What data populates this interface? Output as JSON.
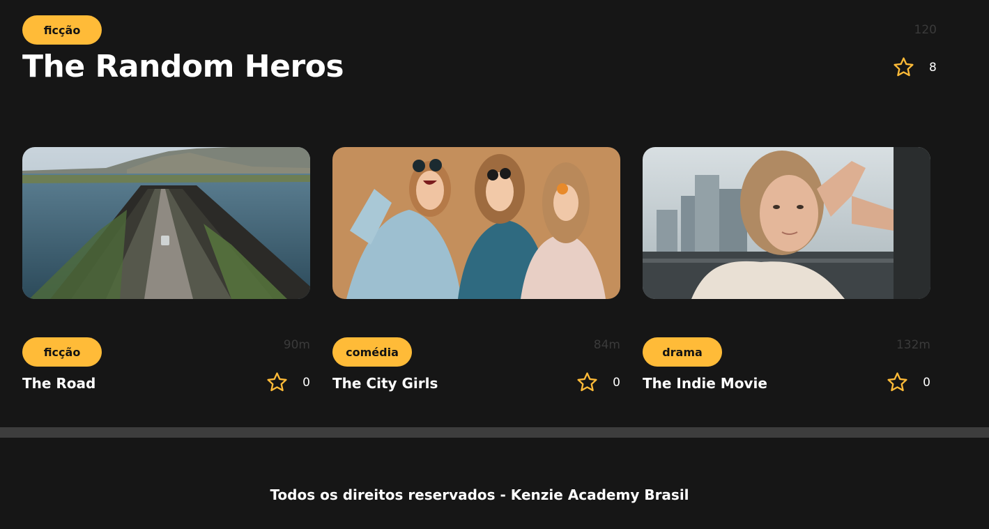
{
  "hero": {
    "genre": "ficção",
    "duration": "120",
    "title": "The Random Heros",
    "rating": "8"
  },
  "movies": [
    {
      "genre": "ficção",
      "duration": "90m",
      "title": "The Road",
      "rating": "0",
      "image": "aerial road through coastal landscape"
    },
    {
      "genre": "comédia",
      "duration": "84m",
      "title": "The City Girls",
      "rating": "0",
      "image": "three laughing women in sunglasses"
    },
    {
      "genre": "drama",
      "duration": "132m",
      "title": "The Indie Movie",
      "rating": "0",
      "image": "woman by a window with city view"
    }
  ],
  "footer": {
    "text": "Todos os direitos reservados - Kenzie Academy Brasil"
  },
  "colors": {
    "background": "#161616",
    "accent": "#ffbb38",
    "muted": "#3a3a3a",
    "divider": "#3d3d3d"
  },
  "icons": {
    "rating": "star-outline-icon"
  }
}
